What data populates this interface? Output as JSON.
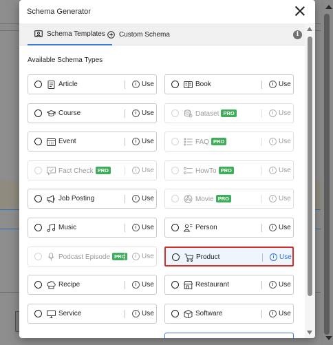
{
  "modal": {
    "title": "Schema Generator",
    "tabs": [
      {
        "label": "Schema Templates",
        "active": true
      },
      {
        "label": "Custom Schema",
        "active": false
      }
    ],
    "section_title": "Available Schema Types",
    "use_label": "Use",
    "pro_label": "PRO"
  },
  "schemas": [
    {
      "label": "Article",
      "pro": false,
      "icon": "document-icon"
    },
    {
      "label": "Book",
      "pro": false,
      "icon": "book-icon"
    },
    {
      "label": "Course",
      "pro": false,
      "icon": "graduation-cap-icon"
    },
    {
      "label": "Dataset",
      "pro": true,
      "icon": "database-icon"
    },
    {
      "label": "Event",
      "pro": false,
      "icon": "calendar-icon"
    },
    {
      "label": "FAQ",
      "pro": true,
      "icon": "list-icon"
    },
    {
      "label": "Fact Check",
      "pro": true,
      "icon": "check-message-icon"
    },
    {
      "label": "HowTo",
      "pro": true,
      "icon": "steps-icon"
    },
    {
      "label": "Job Posting",
      "pro": false,
      "icon": "megaphone-icon"
    },
    {
      "label": "Movie",
      "pro": true,
      "icon": "film-reel-icon"
    },
    {
      "label": "Music",
      "pro": false,
      "icon": "music-note-icon"
    },
    {
      "label": "Person",
      "pro": false,
      "icon": "person-icon"
    },
    {
      "label": "Podcast Episode",
      "pro": true,
      "icon": "microphone-icon"
    },
    {
      "label": "Product",
      "pro": false,
      "icon": "cart-icon",
      "highlighted": true
    },
    {
      "label": "Recipe",
      "pro": false,
      "icon": "chef-hat-icon"
    },
    {
      "label": "Restaurant",
      "pro": false,
      "icon": "store-icon"
    },
    {
      "label": "Service",
      "pro": false,
      "icon": "monitor-icon"
    },
    {
      "label": "Software",
      "pro": false,
      "icon": "box-icon"
    }
  ],
  "colors": {
    "accent": "#3b7ad9",
    "pro_badge": "#3fae5a",
    "highlight_border": "#d62c2c"
  }
}
